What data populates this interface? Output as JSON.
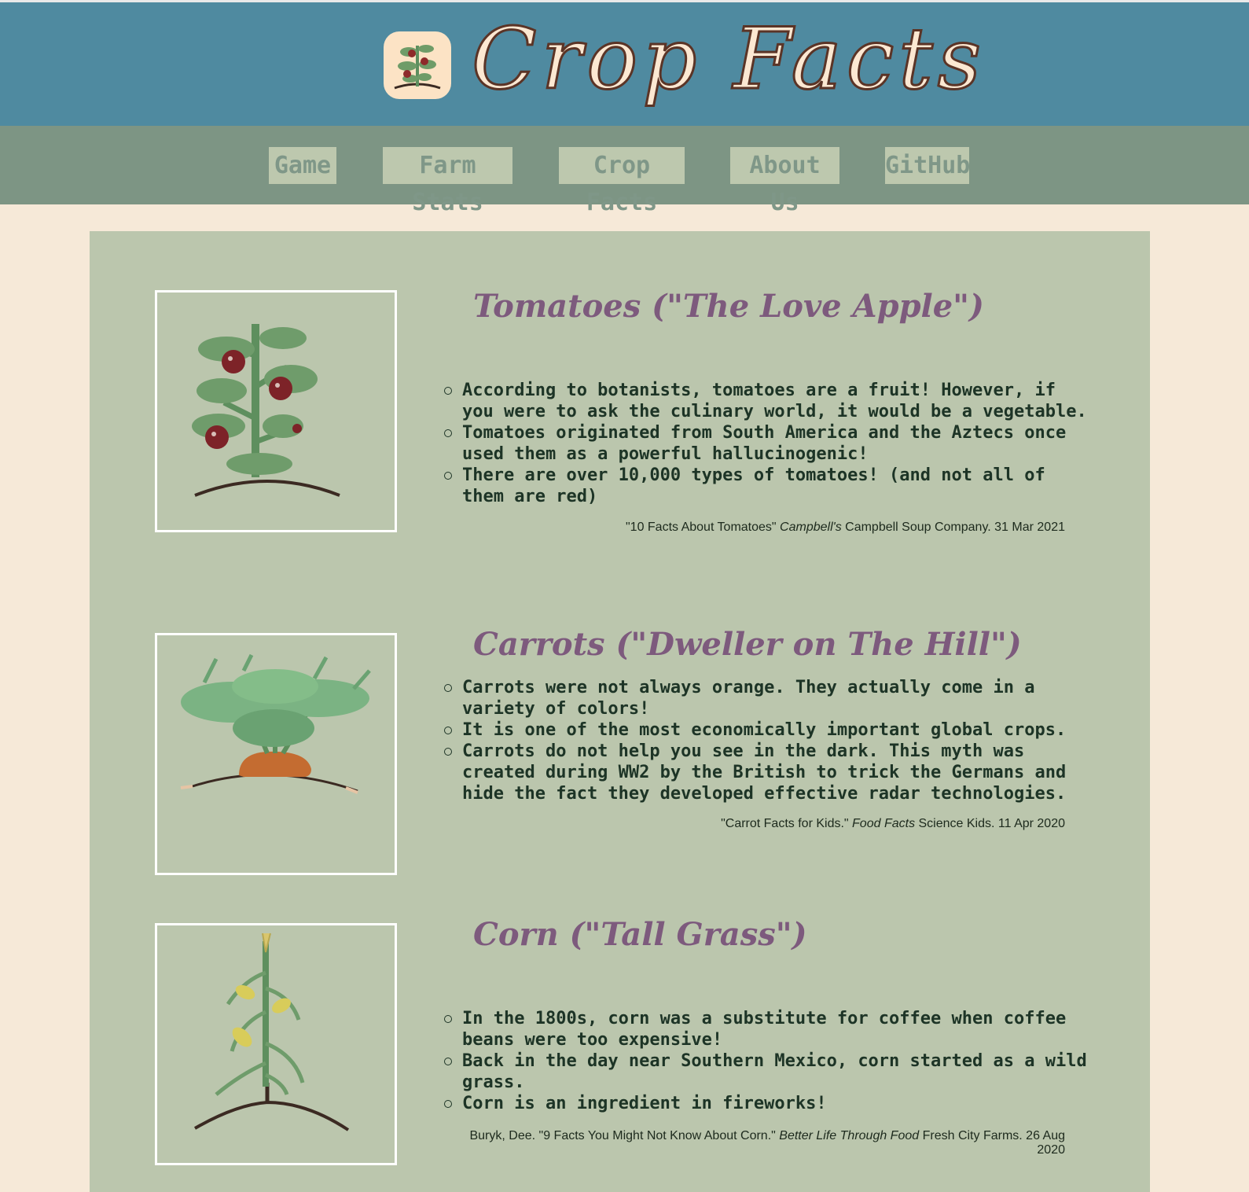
{
  "site": {
    "title": "Crop Facts",
    "logo_icon": "tomato-plant-icon"
  },
  "nav": [
    {
      "label": "Game"
    },
    {
      "label": "Farm Stats"
    },
    {
      "label": "Crop Facts"
    },
    {
      "label": "About Us"
    },
    {
      "label": "GitHub"
    }
  ],
  "crops": [
    {
      "title": "Tomatoes (\"The Love Apple\")",
      "image_icon": "tomato-plant-icon",
      "facts": [
        "According to botanists, tomatoes are a fruit! However, if you were to ask the culinary world, it would be a vegetable.",
        "Tomatoes originated from South America and the Aztecs once used them as a powerful hallucinogenic!",
        "There are over 10,000 types of tomatoes! (and not all of them are red)"
      ],
      "source": {
        "pre": "\"10 Facts About Tomatoes\" ",
        "italic": "Campbell's",
        "post": " Campbell Soup Company. 31 Mar 2021"
      }
    },
    {
      "title": "Carrots (\"Dweller on The Hill\")",
      "image_icon": "carrot-plant-icon",
      "facts": [
        "Carrots were not always orange. They actually come in a variety of colors!",
        "It is one of the most economically important global crops.",
        "Carrots do not help you see in the dark. This myth was created during WW2 by the British to trick the Germans and hide the fact they developed effective radar technologies."
      ],
      "source": {
        "pre": "\"Carrot Facts for Kids.\" ",
        "italic": "Food Facts",
        "post": " Science Kids. 11 Apr 2020"
      }
    },
    {
      "title": "Corn (\"Tall Grass\")",
      "image_icon": "corn-plant-icon",
      "facts": [
        "In the 1800s, corn was a substitute for coffee when coffee beans were too expensive!",
        "Back in the day near Southern Mexico, corn started as a wild grass.",
        "Corn is an ingredient in fireworks!"
      ],
      "source": {
        "pre": "Buryk, Dee. \"9 Facts You Might Not Know About Corn.\" ",
        "italic": "Better Life Through Food",
        "post": " Fresh City Farms. 26 Aug 2020"
      }
    }
  ]
}
